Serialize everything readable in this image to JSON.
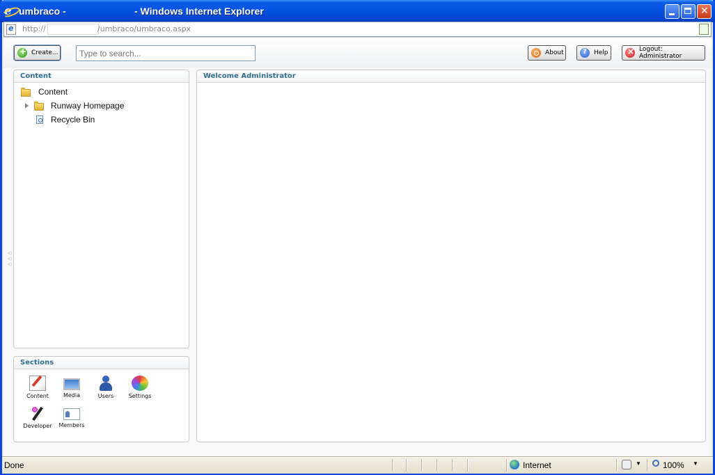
{
  "window": {
    "title_left": "umbraco -",
    "title_right": "- Windows Internet Explorer"
  },
  "address": {
    "url_prefix": "http://",
    "url_suffix": "/umbraco/umbraco.aspx"
  },
  "toolbar": {
    "create_label": "Create...",
    "search_placeholder": "Type to search...",
    "about_label": "About",
    "help_label": "Help",
    "logout_label": "Logout: Administrator"
  },
  "content_panel": {
    "title": "Content",
    "tree": [
      {
        "label": "Content",
        "icon": "folder-icon"
      },
      {
        "label": "Runway Homepage",
        "icon": "folder-icon",
        "expandable": true
      },
      {
        "label": "Recycle Bin",
        "icon": "recycle-bin-icon"
      }
    ]
  },
  "welcome_panel": {
    "title": "Welcome Administrator"
  },
  "sections_panel": {
    "title": "Sections",
    "items": [
      {
        "label": "Content",
        "icon": "content-icon"
      },
      {
        "label": "Media",
        "icon": "media-icon"
      },
      {
        "label": "Users",
        "icon": "users-icon"
      },
      {
        "label": "Settings",
        "icon": "settings-icon"
      },
      {
        "label": "Developer",
        "icon": "developer-icon"
      },
      {
        "label": "Members",
        "icon": "members-icon"
      }
    ]
  },
  "statusbar": {
    "status": "Done",
    "zone": "Internet",
    "zoom": "100%"
  }
}
